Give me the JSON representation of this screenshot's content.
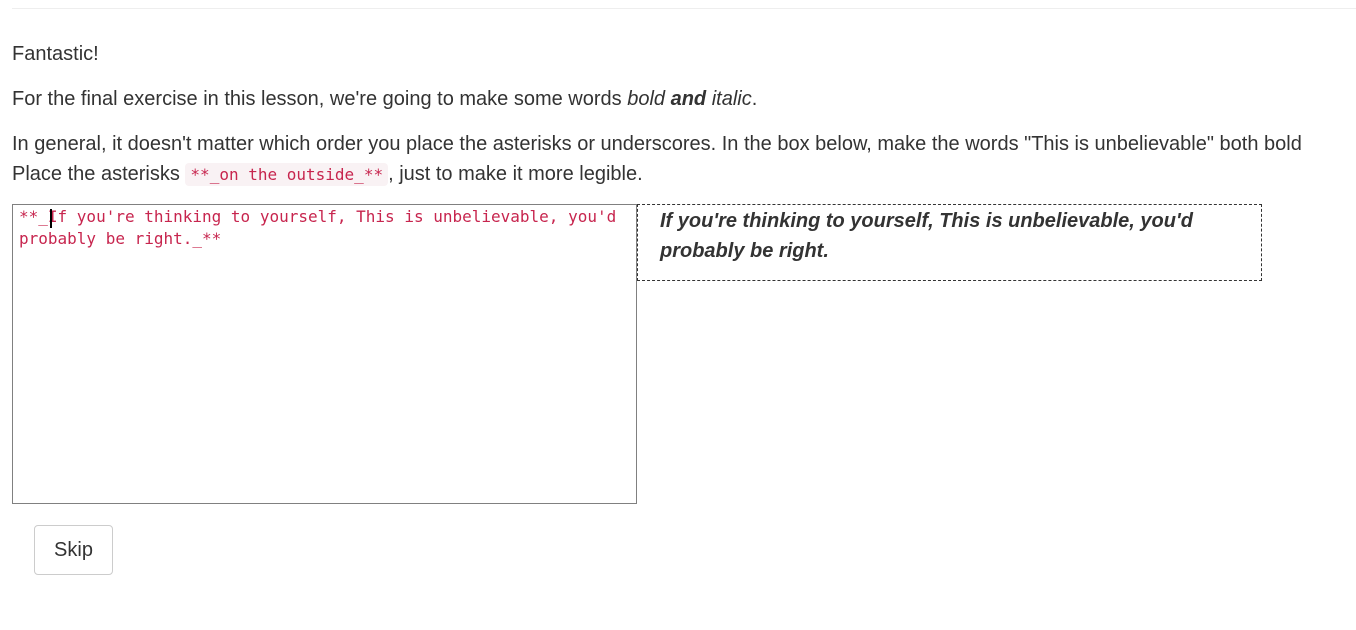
{
  "lesson": {
    "praise": "Fantastic!",
    "intro": {
      "before": "For the final exercise in this lesson, we're going to make some words ",
      "bold_word": "bold",
      "and_word": "and",
      "italic_word": "italic",
      "after": "."
    },
    "instructions": {
      "line1": "In general, it doesn't matter which order you place the asterisks or underscores. In the box below, make the words \"This is unbelievable\" both bold",
      "line2_before": "Place the asterisks ",
      "line2_code": "**_on the outside_**",
      "line2_after": ", just to make it more legible."
    }
  },
  "editor": {
    "value": "**_If you're thinking to yourself, This is unbelievable, you'd probably be right._**"
  },
  "preview": {
    "text": "If you're thinking to yourself, This is unbelievable, you'd probably be right."
  },
  "actions": {
    "skip_label": "Skip"
  }
}
